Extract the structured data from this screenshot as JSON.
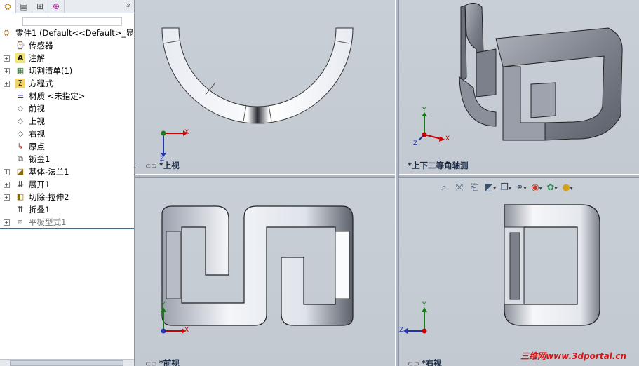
{
  "sidebar": {
    "tabs": [
      {
        "icon": "feature-manager-icon"
      },
      {
        "icon": "property-manager-icon"
      },
      {
        "icon": "configuration-manager-icon"
      },
      {
        "icon": "dimxpert-icon"
      }
    ],
    "expand_glyph": "»",
    "root": {
      "label": "零件1  (Default<<Default>_显"
    },
    "items": [
      {
        "label": "传感器",
        "icon": "sensor-icon",
        "expandable": false
      },
      {
        "label": "注解",
        "icon": "annotation-icon",
        "expandable": true
      },
      {
        "label": "切割清单(1)",
        "icon": "cut-list-icon",
        "expandable": true
      },
      {
        "label": "方程式",
        "icon": "equation-icon",
        "expandable": true
      },
      {
        "label": "材质 <未指定>",
        "icon": "material-icon",
        "expandable": false
      },
      {
        "label": "前视",
        "icon": "plane-icon",
        "expandable": false
      },
      {
        "label": "上视",
        "icon": "plane-icon",
        "expandable": false
      },
      {
        "label": "右视",
        "icon": "plane-icon",
        "expandable": false
      },
      {
        "label": "原点",
        "icon": "origin-icon",
        "expandable": false
      },
      {
        "label": "钣金1",
        "icon": "sheet-metal-icon",
        "expandable": false
      },
      {
        "label": "基体-法兰1",
        "icon": "base-flange-icon",
        "expandable": true
      },
      {
        "label": "展开1",
        "icon": "unfold-icon",
        "expandable": true
      },
      {
        "label": "切除-拉伸2",
        "icon": "cut-extrude-icon",
        "expandable": true
      },
      {
        "label": "折叠1",
        "icon": "fold-icon",
        "expandable": false
      },
      {
        "label": "平板型式1",
        "icon": "flat-pattern-icon",
        "expandable": true,
        "dim": true
      }
    ]
  },
  "viewports": {
    "top": {
      "label": "*上视"
    },
    "iso": {
      "label": "*上下二等角轴测"
    },
    "front": {
      "label": "*前视"
    },
    "right": {
      "label": "*右视"
    }
  },
  "axes": {
    "x": "X",
    "y": "Y",
    "z": "Z"
  },
  "view_toolbar": [
    {
      "icon": "zoom-to-fit-icon"
    },
    {
      "icon": "zoom-area-icon"
    },
    {
      "icon": "previous-view-icon"
    },
    {
      "icon": "section-view-icon"
    },
    {
      "icon": "view-orientation-icon"
    },
    {
      "icon": "display-style-icon"
    },
    {
      "icon": "hide-show-items-icon"
    },
    {
      "icon": "edit-appearance-icon"
    },
    {
      "icon": "apply-scene-icon"
    },
    {
      "icon": "view-settings-icon"
    }
  ],
  "watermark": "三维网www.3dportal.cn",
  "colors": {
    "viewport_bg": "#c7cdd5",
    "selection_line": "#3b6aa8",
    "watermark": "#d4181a"
  }
}
